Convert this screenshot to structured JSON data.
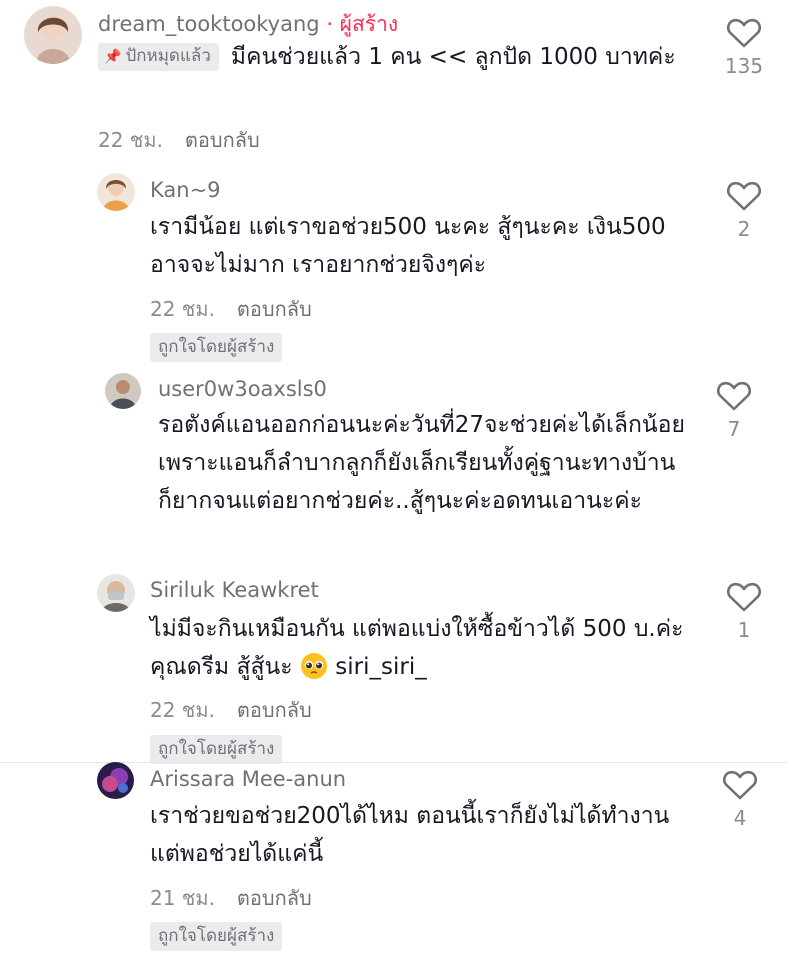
{
  "comments": [
    {
      "username": "dream_tooktookyang",
      "creator_tag": "· ผู้สร้าง",
      "pinned_label": "ปักหมุดแล้ว",
      "text": "มีคนช่วยแล้ว 1 คน << ลูกปัด 1000 บาทค่ะ",
      "time": "22 ชม.",
      "reply_label": "ตอบกลับ",
      "likes": "135"
    },
    {
      "username": "Kan~9",
      "text": "เรามีน้อย แต่เราขอช่วย500 นะคะ สู้ๆนะคะ เงิน500 อาจจะไม่มาก เราอยากช่วยจิงๆค่ะ",
      "time": "22 ชม.",
      "reply_label": "ตอบกลับ",
      "liked_by_creator": "ถูกใจโดยผู้สร้าง",
      "likes": "2"
    },
    {
      "username": "user0w3oaxsls0",
      "text": "รอตังค์แอนออกก่อนนะค่ะวันที่27จะช่วยค่ะได้เล็กน้อยเพราะแอนก็ลำบากลูกก็ยังเล็กเรียนทั้งคู่ฐานะทางบ้านก็ยากจนแต่อยากช่วยค่ะ..สู้ๆนะค่ะอดทนเอานะค่ะ",
      "likes": "7"
    },
    {
      "username": "Siriluk Keawkret",
      "text": "ไม่มีจะกินเหมือนกัน แต่พอแบ่งให้ซื้อข้าวได้ 500 บ.ค่ะคุณดรีม สู้สู้นะ",
      "mention": "siri_siri_",
      "time": "22 ชม.",
      "reply_label": "ตอบกลับ",
      "liked_by_creator": "ถูกใจโดยผู้สร้าง",
      "likes": "1"
    },
    {
      "username": "Arissara Mee-anun",
      "text": "เราช่วยขอช่วย200ได้ไหม ตอนนี้เราก็ยังไม่ได้ทำงาน แต่พอช่วยได้แค่นี้",
      "time": "21 ชม.",
      "reply_label": "ตอบกลับ",
      "liked_by_creator": "ถูกใจโดยผู้สร้าง",
      "likes": "4"
    }
  ],
  "icons": {
    "like": "heart-outline-icon",
    "pin": "pin-icon",
    "emoji": "pleading-face-emoji"
  },
  "colors": {
    "creator_tag": "#fe2c55",
    "username": "#6f7178",
    "meta": "#8a8b91",
    "badge_bg": "#ebebed"
  }
}
